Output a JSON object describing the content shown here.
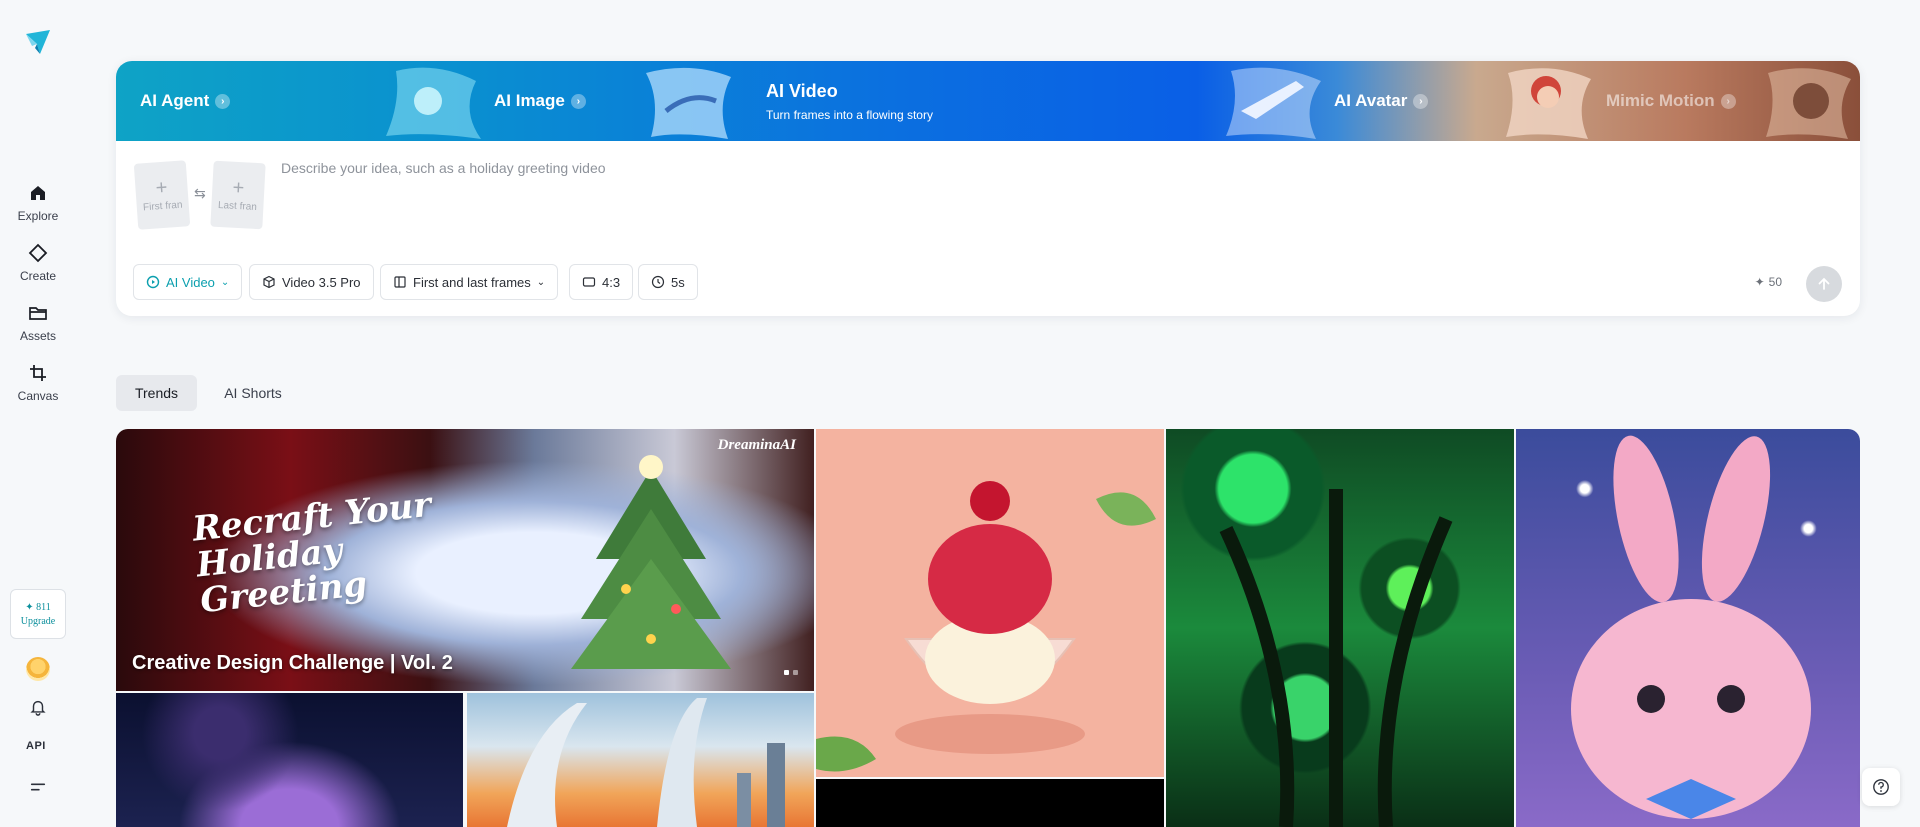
{
  "sidebar": {
    "items": [
      {
        "label": "Explore",
        "icon": "home-icon"
      },
      {
        "label": "Create",
        "icon": "diamond-icon"
      },
      {
        "label": "Assets",
        "icon": "folder-icon"
      },
      {
        "label": "Canvas",
        "icon": "crop-icon"
      }
    ],
    "credits": "811",
    "upgrade_label": "Upgrade",
    "api_label": "API"
  },
  "hero": {
    "tabs": [
      {
        "label": "AI Agent"
      },
      {
        "label": "AI Image"
      },
      {
        "label": "AI Video",
        "subtitle": "Turn frames into a flowing story",
        "active": true
      },
      {
        "label": "AI Avatar"
      },
      {
        "label": "Mimic Motion"
      }
    ],
    "first_frame_label": "First fran",
    "last_frame_label": "Last fran",
    "prompt_placeholder": "Describe your idea, such as a holiday greeting video",
    "controls": {
      "mode": "AI Video",
      "model": "Video 3.5 Pro",
      "frames": "First and last frames",
      "ratio": "4:3",
      "duration": "5s"
    },
    "cost": "50"
  },
  "feed_tabs": [
    {
      "label": "Trends",
      "active": true
    },
    {
      "label": "AI Shorts",
      "active": false
    }
  ],
  "gallery": {
    "featured_title": "Creative Design Challenge | Vol. 2",
    "featured_art_text": "Recraft Your Holiday Greeting",
    "brand": "DreaminaAI"
  },
  "colors": {
    "accent": "#0b9fae",
    "background": "#f6f8fa"
  }
}
